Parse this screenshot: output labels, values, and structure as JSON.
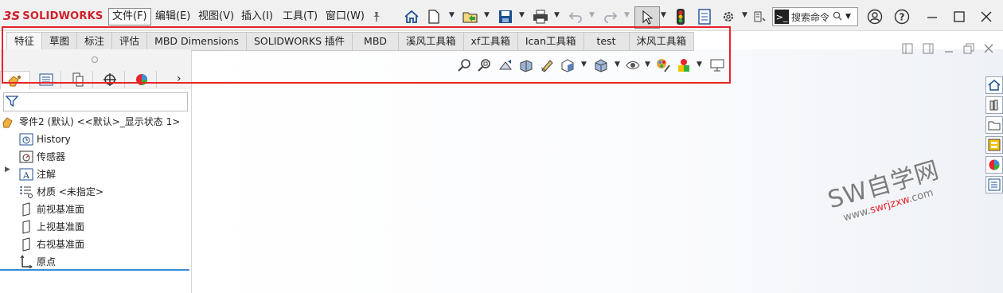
{
  "app": {
    "brand_prefix": "3S",
    "brand": "SOLIDWORKS"
  },
  "menu": [
    "文件(F)",
    "编辑(E)",
    "视图(V)",
    "插入(I)",
    "工具(T)",
    "窗口(W)"
  ],
  "search": {
    "placeholder": "搜索命令"
  },
  "tabs": [
    "特征",
    "草图",
    "标注",
    "评估",
    "MBD Dimensions",
    "SOLIDWORKS 插件",
    "MBD",
    "溪风工具箱",
    "xf工具箱",
    "Ican工具箱",
    "test",
    "沐风工具箱"
  ],
  "tree": {
    "root": "零件2 (默认) <<默认>_显示状态 1>",
    "items": [
      "History",
      "传感器",
      "注解",
      "材质 <未指定>",
      "前视基准面",
      "上视基准面",
      "右视基准面",
      "原点"
    ]
  },
  "watermark": {
    "title": "SW自学网",
    "url_prefix": "www.",
    "url_main": "swrjzxw",
    "url_suffix": ".com"
  },
  "colors": {
    "accent_red": "#e8242a",
    "brand_red": "#d0202a",
    "selection_blue": "#3a8ad6"
  }
}
